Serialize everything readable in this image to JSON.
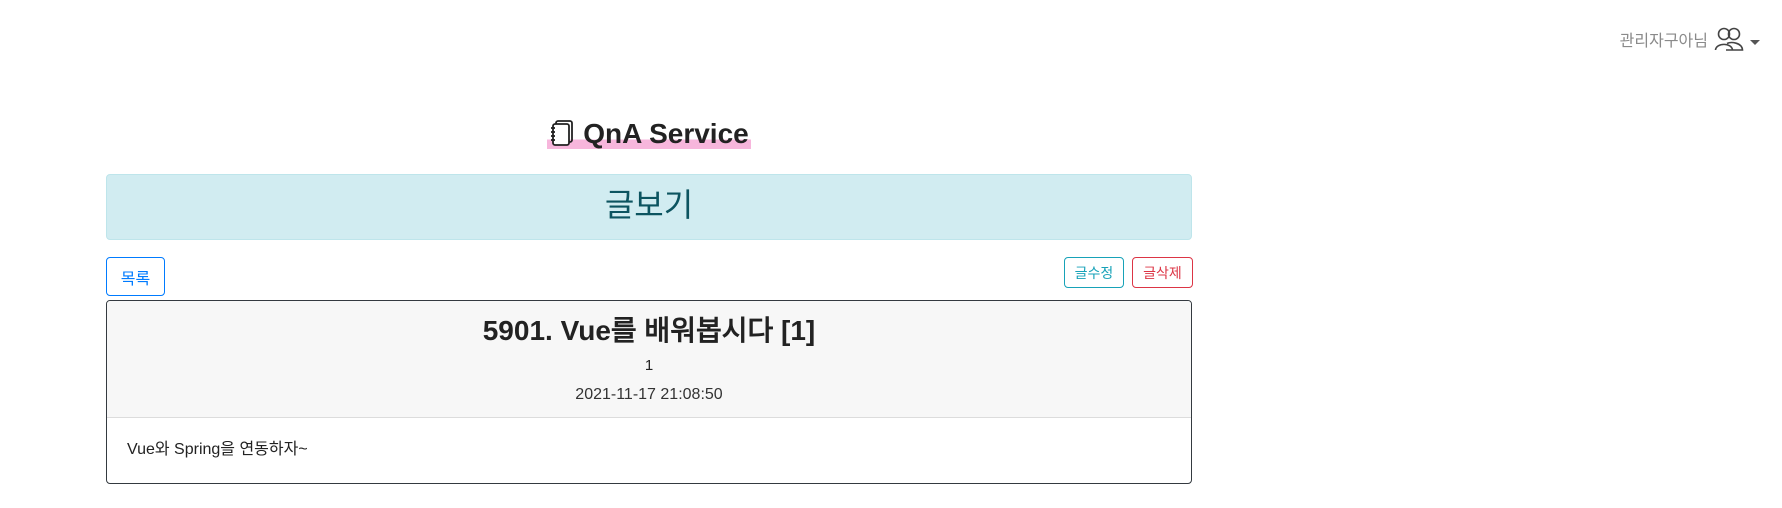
{
  "header": {
    "user_name": "관리자구아님",
    "user_icon": "users-icon",
    "caret_icon": "caret-down-icon"
  },
  "title": {
    "icon": "notebook-icon",
    "text": "QnA Service",
    "highlight_color": "#f7b6dc"
  },
  "banner": {
    "text": "글보기",
    "background": "#d1ecf1",
    "color": "#0c5460"
  },
  "toolbar": {
    "list_label": "목록",
    "edit_label": "글수정",
    "delete_label": "글삭제"
  },
  "post": {
    "title": "5901. Vue를 배워봅시다 [1]",
    "count": "1",
    "date": "2021-11-17 21:08:50",
    "content": "Vue와 Spring을 연동하자~"
  },
  "colors": {
    "primary": "#007bff",
    "info": "#17a2b8",
    "danger": "#dc3545"
  }
}
